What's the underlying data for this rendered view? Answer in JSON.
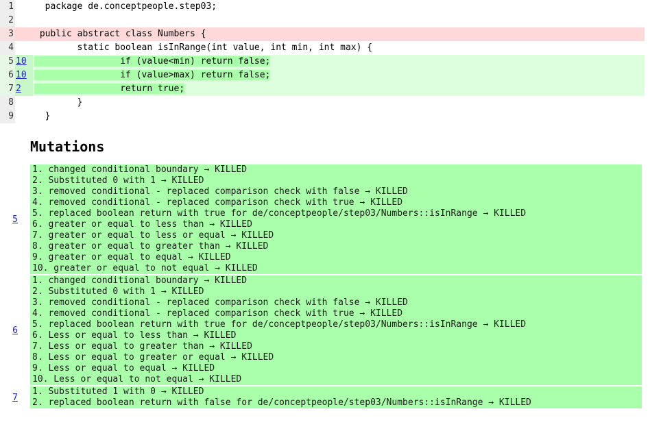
{
  "colors": {
    "killed_green": "#aaffaa",
    "covered_row_green": "#ddffdd",
    "survived_pink": "#ffd9d9",
    "gutter_gray": "#eeeeee",
    "link_blue": "#2222cc"
  },
  "source": {
    "lines": [
      {
        "number": "1",
        "hits": "",
        "status": "none",
        "code": "  package de.conceptpeople.step03;",
        "highlight": ""
      },
      {
        "number": "2",
        "hits": "",
        "status": "none",
        "code": "",
        "highlight": ""
      },
      {
        "number": "3",
        "hits": "",
        "status": "survived",
        "code": " public abstract class Numbers {",
        "highlight": ""
      },
      {
        "number": "4",
        "hits": "",
        "status": "none",
        "code": "        static boolean isInRange(int value, int min, int max) {",
        "highlight": ""
      },
      {
        "number": "5",
        "hits": "10",
        "status": "covered",
        "code": "                if (value<min) return false;",
        "highlight": "                if (value<min) return false;"
      },
      {
        "number": "6",
        "hits": "10",
        "status": "covered",
        "code": "                if (value>max) return false;",
        "highlight": "                if (value>max) return false;"
      },
      {
        "number": "7",
        "hits": "2",
        "status": "covered",
        "code": "                return true;",
        "highlight": "                return true;"
      },
      {
        "number": "8",
        "hits": "",
        "status": "none",
        "code": "        }",
        "highlight": ""
      },
      {
        "number": "9",
        "hits": "",
        "status": "none",
        "code": "  }",
        "highlight": ""
      }
    ]
  },
  "mutations": {
    "heading": "Mutations",
    "blocks": [
      {
        "line": "5",
        "items": [
          "1. changed conditional boundary → KILLED",
          "2. Substituted 0 with 1 → KILLED",
          "3. removed conditional - replaced comparison check with false → KILLED",
          "4. removed conditional - replaced comparison check with true → KILLED",
          "5. replaced boolean return with true for de/conceptpeople/step03/Numbers::isInRange → KILLED",
          "6. greater or equal to less than → KILLED",
          "7. greater or equal to less or equal → KILLED",
          "8. greater or equal to greater than → KILLED",
          "9. greater or equal to equal → KILLED",
          "10. greater or equal to not equal → KILLED"
        ]
      },
      {
        "line": "6",
        "items": [
          "1. changed conditional boundary → KILLED",
          "2. Substituted 0 with 1 → KILLED",
          "3. removed conditional - replaced comparison check with false → KILLED",
          "4. removed conditional - replaced comparison check with true → KILLED",
          "5. replaced boolean return with true for de/conceptpeople/step03/Numbers::isInRange → KILLED",
          "6. Less or equal to less than → KILLED",
          "7. Less or equal to greater than → KILLED",
          "8. Less or equal to greater or equal → KILLED",
          "9. Less or equal to equal → KILLED",
          "10. Less or equal to not equal → KILLED"
        ]
      },
      {
        "line": "7",
        "items": [
          "1. Substituted 1 with 0 → KILLED",
          "2. replaced boolean return with false for de/conceptpeople/step03/Numbers::isInRange → KILLED"
        ]
      }
    ]
  }
}
